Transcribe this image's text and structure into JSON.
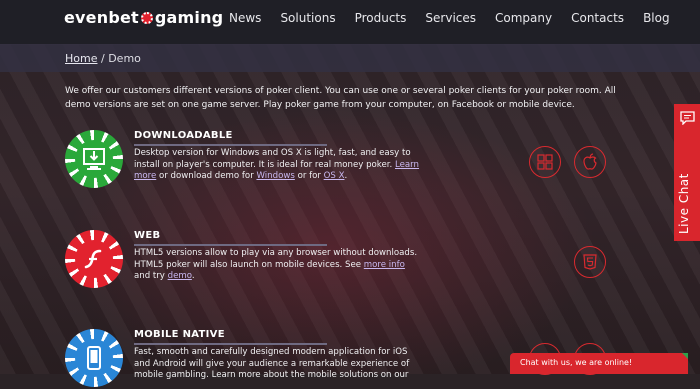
{
  "header": {
    "logo_left": "evenbet",
    "logo_right": "gaming",
    "nav": [
      "News",
      "Solutions",
      "Products",
      "Services",
      "Company",
      "Contacts",
      "Blog"
    ]
  },
  "breadcrumb": {
    "home": "Home",
    "separator": "/",
    "current": "Demo"
  },
  "intro": "We offer our customers different versions of poker client. You can use one or several poker clients for your poker room. All demo versions are set on one game server. Play poker game from your computer, on Facebook or mobile device.",
  "products": {
    "downloadable": {
      "title": "DOWNLOADABLE",
      "desc": "Desktop version for Windows and OS X is light, fast, and easy to install on player's computer. It is ideal for real money poker.",
      "learn_more": "Learn more",
      "mid": " or download demo for ",
      "windows": "Windows",
      "or_for": " or for ",
      "osx": "OS X",
      "end": ".",
      "icons": [
        "windows-icon",
        "apple-icon"
      ]
    },
    "web": {
      "title": "WEB",
      "desc": "HTML5 versions allow to play via any browser without downloads. HTML5 poker will also launch on mobile devices. See ",
      "more_info": "more info",
      "and_try": " and try ",
      "demo": "demo",
      "end": ".",
      "icons": [
        "html5-icon"
      ]
    },
    "mobile": {
      "title": "MOBILE NATIVE",
      "desc": "Fast, smooth and carefully designed modern application for iOS and Android will give your audience a remarkable experience of mobile gambling. Learn more about the mobile solutions on our"
    }
  },
  "live_chat": {
    "label": "Live Chat"
  },
  "chat_bubble": {
    "text": "Chat with us, we are online!"
  },
  "colors": {
    "accent": "#d9262d",
    "green_chip": "#2aa83a",
    "red_chip": "#e2222e",
    "blue_chip": "#2a86d6"
  }
}
